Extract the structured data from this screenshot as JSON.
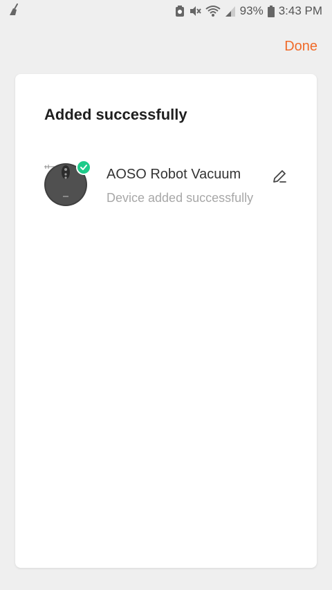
{
  "status_bar": {
    "battery_percent": "93%",
    "time": "3:43 PM",
    "icons": [
      "broom-icon",
      "battery-saver-icon",
      "mute-icon",
      "wifi-icon",
      "signal-icon",
      "battery-icon"
    ]
  },
  "header": {
    "done_label": "Done"
  },
  "card": {
    "title": "Added successfully",
    "device": {
      "name": "AOSO Robot Vacuum",
      "status": "Device added successfully",
      "image_icon": "robot-vacuum-icon",
      "badge_icon": "check-icon",
      "edit_icon": "pencil-icon"
    }
  },
  "colors": {
    "accent": "#f06a28",
    "success": "#1ecb8a",
    "background": "#efefef",
    "card": "#ffffff"
  }
}
